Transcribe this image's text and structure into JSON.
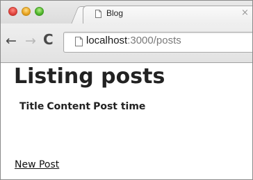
{
  "browser": {
    "tab_title": "Blog",
    "tab_close": "×",
    "back_icon": "←",
    "forward_icon": "→",
    "reload_icon": "C",
    "url_host": "localhost",
    "url_rest": ":3000/posts"
  },
  "page": {
    "title": "Listing posts",
    "columns": [
      "Title",
      "Content",
      "Post time"
    ],
    "new_link": "New Post"
  }
}
